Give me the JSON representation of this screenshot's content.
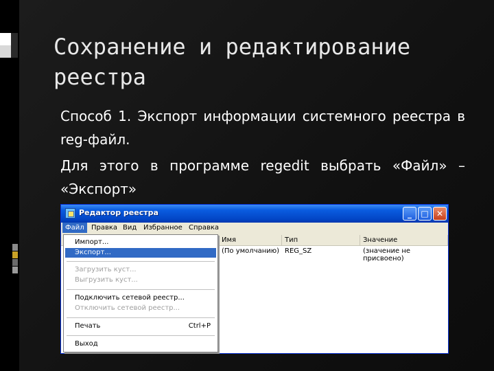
{
  "slide": {
    "title": "Сохранение и редактирование реестра",
    "paragraph1": "Способ 1. Экспорт информации системного реестра в reg-файл.",
    "paragraph2": "Для этого в программе regedit выбрать «Файл» – «Экспорт»"
  },
  "window": {
    "title": "Редактор реестра",
    "buttons": {
      "minimize": "_",
      "maximize": "□",
      "close": "✕"
    },
    "menu": [
      "Файл",
      "Правка",
      "Вид",
      "Избранное",
      "Справка"
    ],
    "columns": [
      "",
      "Имя",
      "Тип",
      "Значение"
    ],
    "row": {
      "name": "(По умолчанию)",
      "type": "REG_SZ",
      "value": "(значение не присвоено)"
    }
  },
  "file_menu": {
    "items": [
      {
        "label": "Импорт...",
        "state": "normal"
      },
      {
        "label": "Экспорт...",
        "state": "selected"
      },
      {
        "label": "Загрузить куст...",
        "state": "disabled"
      },
      {
        "label": "Выгрузить куст...",
        "state": "disabled"
      },
      {
        "label": "Подключить сетевой реестр...",
        "state": "normal"
      },
      {
        "label": "Отключить сетевой реестр...",
        "state": "disabled"
      },
      {
        "label": "Печать",
        "state": "normal",
        "shortcut": "Ctrl+P"
      },
      {
        "label": "Выход",
        "state": "normal"
      }
    ]
  },
  "colors": {
    "slide_bg": "#141414",
    "titlebar": "#0a5ce0",
    "selection": "#316ac5",
    "deco_gray": "#7a7a7a",
    "deco_gold": "#c9a227"
  }
}
